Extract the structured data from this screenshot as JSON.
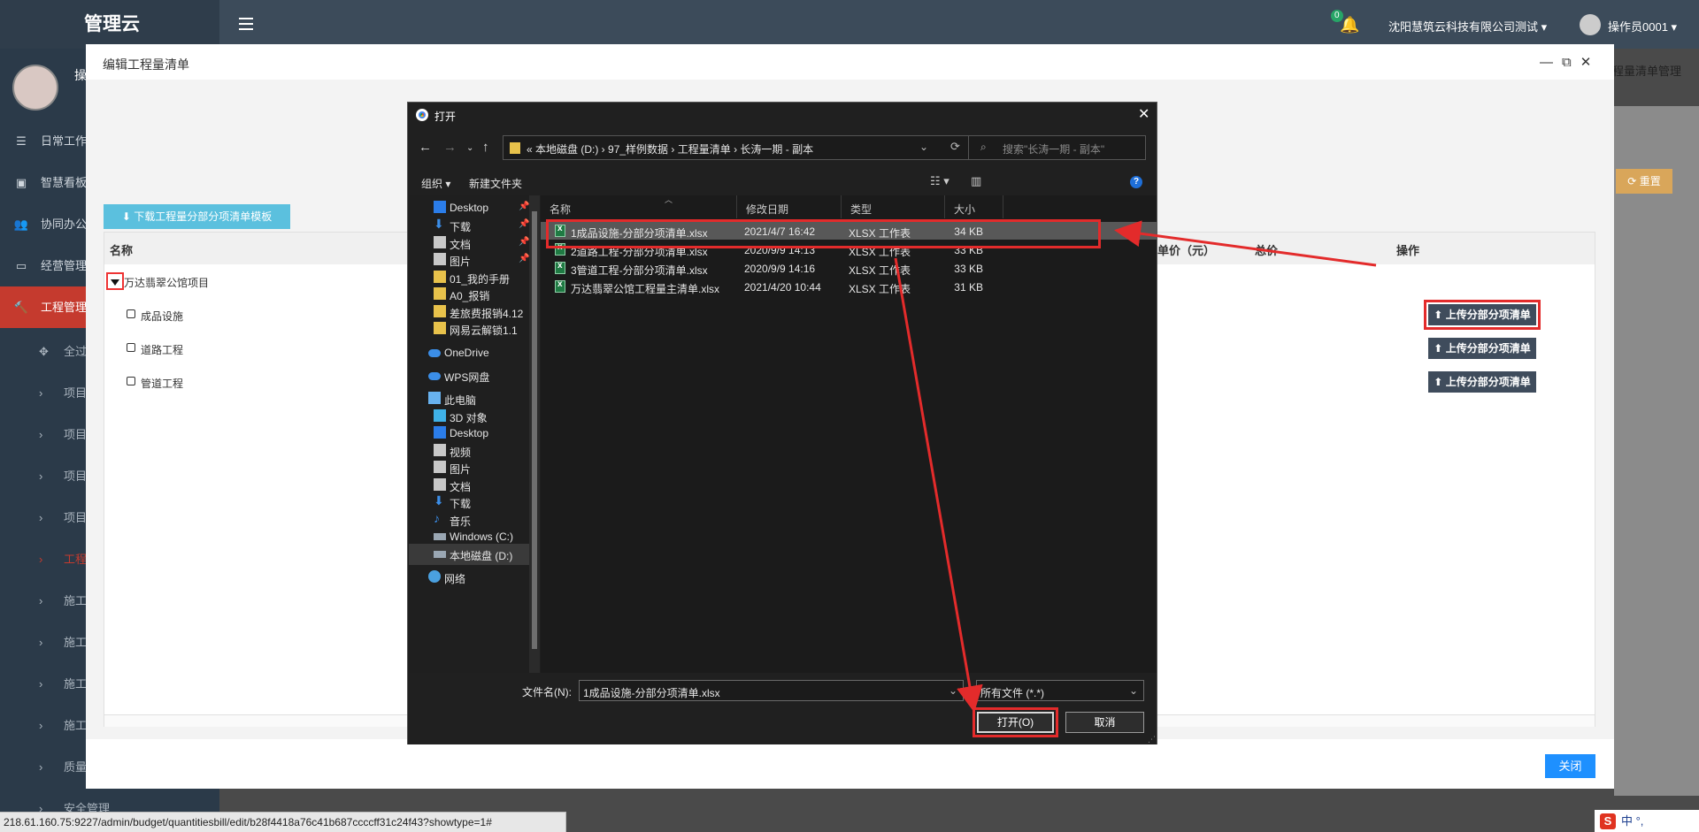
{
  "app": {
    "brand": "管理云",
    "notification_count": "0",
    "company": "沈阳慧筑云科技有限公司测试",
    "operator": "操作员0001",
    "user_initial": "操",
    "breadcrumb_right": "程量清单管理",
    "reset_label": "重置",
    "status_url": "218.61.160.75:9227/admin/budget/quantitiesbill/edit/b28f4418a76c41b687ccccff31c24f43?showtype=1#",
    "ime": "中 °,"
  },
  "sidebar": {
    "items": [
      {
        "label": "日常工作"
      },
      {
        "label": "智慧看板"
      },
      {
        "label": "协同办公"
      },
      {
        "label": "经营管理"
      },
      {
        "label": "工程管理"
      }
    ],
    "subitems": [
      {
        "label": "全过"
      },
      {
        "label": "项目"
      },
      {
        "label": "项目"
      },
      {
        "label": "项目"
      },
      {
        "label": "项目"
      },
      {
        "label": "工程"
      },
      {
        "label": "施工"
      },
      {
        "label": "施工"
      },
      {
        "label": "施工"
      },
      {
        "label": "施工"
      },
      {
        "label": "质量"
      },
      {
        "label": "安全管理"
      }
    ]
  },
  "modal": {
    "title": "编辑工程量清单",
    "download_template": "下载工程量分部分项清单模板",
    "columns": {
      "name": "名称",
      "unit_price": "单价（元）",
      "total": "总价",
      "action": "操作"
    },
    "project": "万达翡翠公馆项目",
    "rows": [
      {
        "name": "成品设施",
        "action": "上传分部分项清单"
      },
      {
        "name": "道路工程",
        "action": "上传分部分项清单"
      },
      {
        "name": "管道工程",
        "action": "上传分部分项清单"
      }
    ],
    "close_label": "关闭"
  },
  "dialog": {
    "title": "打开",
    "path": [
      "本地磁盘 (D:)",
      "97_样例数据",
      "工程量清单",
      "长涛一期 - 副本"
    ],
    "search_placeholder": "搜索\"长涛一期 - 副本\"",
    "organize": "组织 ▾",
    "new_folder": "新建文件夹",
    "nav_items": [
      {
        "label": "Desktop",
        "icon": "desktop-icon",
        "pinned": true
      },
      {
        "label": "下载",
        "icon": "download-icon",
        "pinned": true
      },
      {
        "label": "文档",
        "icon": "documents-icon",
        "pinned": true
      },
      {
        "label": "图片",
        "icon": "pictures-icon",
        "pinned": true
      },
      {
        "label": "01_我的手册",
        "icon": "folder-icon"
      },
      {
        "label": "A0_报销",
        "icon": "folder-icon"
      },
      {
        "label": "差旅费报销4.12",
        "icon": "folder-icon"
      },
      {
        "label": "网易云解锁1.1",
        "icon": "folder-icon"
      },
      {
        "label": "OneDrive",
        "icon": "onedrive-icon"
      },
      {
        "label": "WPS网盘",
        "icon": "wps-cloud-icon"
      },
      {
        "label": "此电脑",
        "icon": "this-pc-icon"
      },
      {
        "label": "3D 对象",
        "icon": "3d-objects-icon"
      },
      {
        "label": "Desktop",
        "icon": "desktop-icon"
      },
      {
        "label": "视频",
        "icon": "videos-icon"
      },
      {
        "label": "图片",
        "icon": "pictures-icon"
      },
      {
        "label": "文档",
        "icon": "documents-icon"
      },
      {
        "label": "下载",
        "icon": "download-icon"
      },
      {
        "label": "音乐",
        "icon": "music-icon"
      },
      {
        "label": "Windows (C:)",
        "icon": "drive-c-icon"
      },
      {
        "label": "本地磁盘 (D:)",
        "icon": "drive-d-icon",
        "selected": true
      },
      {
        "label": "网络",
        "icon": "network-icon"
      }
    ],
    "columns": {
      "name": "名称",
      "date": "修改日期",
      "type": "类型",
      "size": "大小"
    },
    "files": [
      {
        "name": "1成品设施-分部分项清单.xlsx",
        "date": "2021/4/7 16:42",
        "type": "XLSX 工作表",
        "size": "34 KB",
        "selected": true
      },
      {
        "name": "2道路工程-分部分项清单.xlsx",
        "date": "2020/9/9 14:13",
        "type": "XLSX 工作表",
        "size": "33 KB"
      },
      {
        "name": "3管道工程-分部分项清单.xlsx",
        "date": "2020/9/9 14:16",
        "type": "XLSX 工作表",
        "size": "33 KB"
      },
      {
        "name": "万达翡翠公馆工程量主清单.xlsx",
        "date": "2021/4/20 10:44",
        "type": "XLSX 工作表",
        "size": "31 KB"
      }
    ],
    "filename_label": "文件名(N):",
    "filename_value": "1成品设施-分部分项清单.xlsx",
    "filetype_value": "所有文件 (*.*)",
    "open_label": "打开(O)",
    "cancel_label": "取消"
  },
  "colors": {
    "annotation": "#e32b2b",
    "accent_red": "#c53a2e",
    "primary_blue": "#1e90ff",
    "dialog_bg": "#202020"
  }
}
